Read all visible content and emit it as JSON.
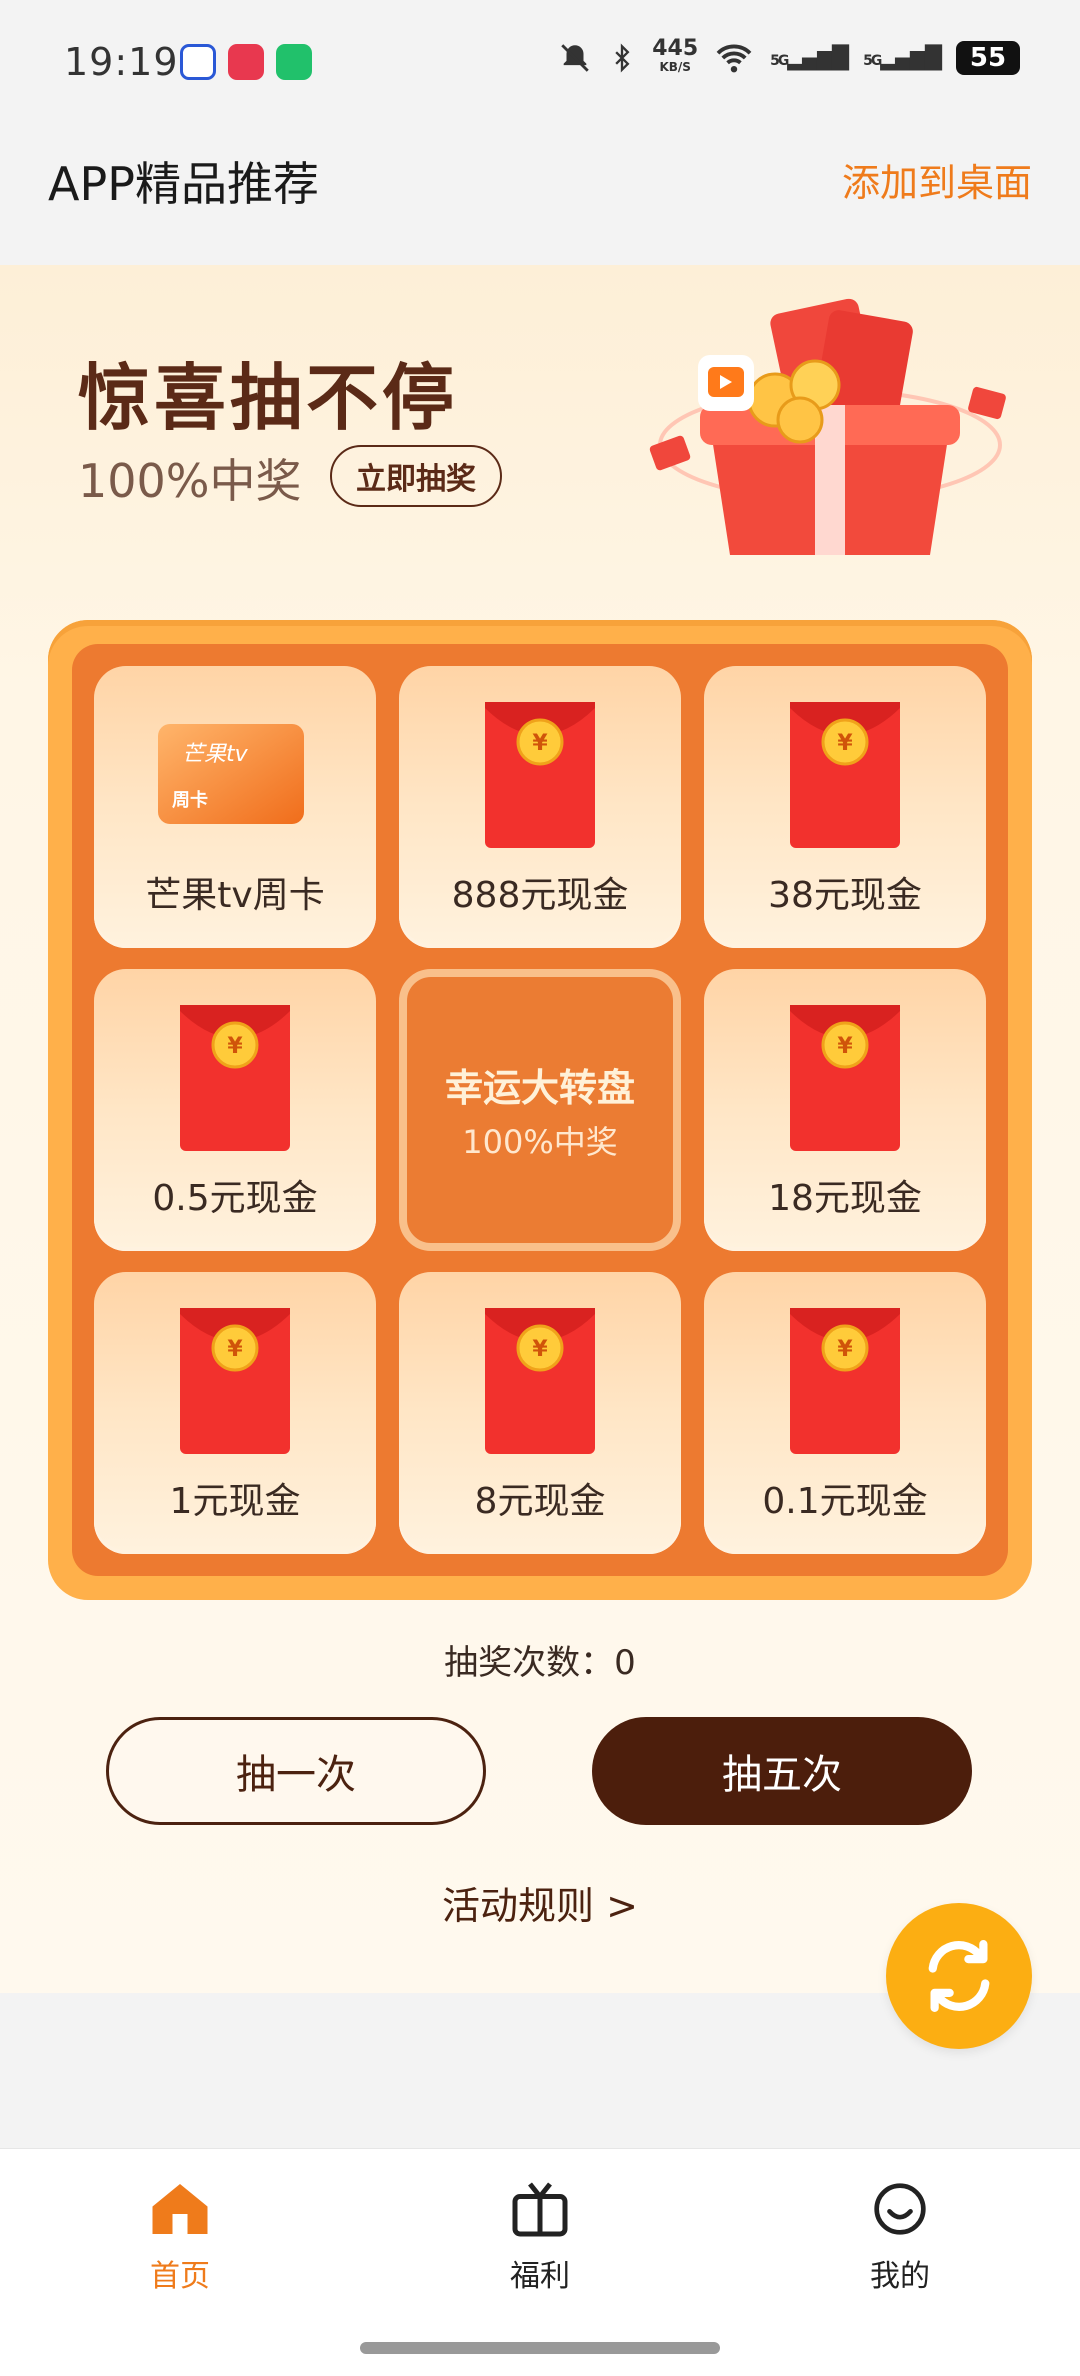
{
  "status_bar": {
    "time": "19:19",
    "net_speed_value": "445",
    "net_speed_unit": "KB/S",
    "signal_1": "5G",
    "signal_2": "5G",
    "battery": "55",
    "icons": [
      "baidu-icon",
      "video-app-icon",
      "iqiyi-icon",
      "mute-icon",
      "bluetooth-icon",
      "wifi-icon",
      "signal-icon",
      "battery-icon"
    ]
  },
  "header": {
    "title": "APP精品推荐",
    "add_to_desktop": "添加到桌面"
  },
  "banner": {
    "title": "惊喜抽不停",
    "subtitle": "100%中奖",
    "draw_now": "立即抽奖"
  },
  "prizes": [
    {
      "label": "芒果tv周卡",
      "type": "card",
      "card_brand": "芒果tv",
      "card_sub": "周卡"
    },
    {
      "label": "888元现金",
      "type": "redpack"
    },
    {
      "label": "38元现金",
      "type": "redpack"
    },
    {
      "label": "0.5元现金",
      "type": "redpack"
    },
    {
      "label": "18元现金",
      "type": "redpack"
    },
    {
      "label": "1元现金",
      "type": "redpack"
    },
    {
      "label": "8元现金",
      "type": "redpack"
    },
    {
      "label": "0.1元现金",
      "type": "redpack"
    }
  ],
  "center": {
    "title": "幸运大转盘",
    "subtitle": "100%中奖"
  },
  "draw_count_text": "抽奖次数：0",
  "actions": {
    "draw_once": "抽一次",
    "draw_five": "抽五次",
    "rules": "活动规则 >"
  },
  "nav": {
    "home": "首页",
    "welfare": "福利",
    "mine": "我的"
  },
  "colors": {
    "accent_orange": "#ef7b1b",
    "brown_dark": "#4c1e0c",
    "grid_orange": "#ed7a30",
    "fab_yellow": "#fcae12"
  }
}
